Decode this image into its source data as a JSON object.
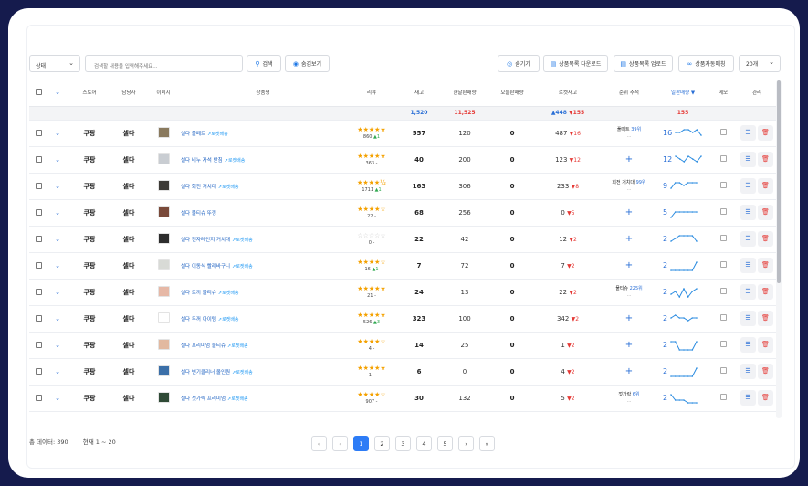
{
  "toolbar": {
    "status_select": "상태",
    "search_placeholder": "검색할 내용을 입력해주세요...",
    "search_btn": "검색",
    "hidden_view_btn": "숨김보기",
    "hide_btn": "숨기기",
    "download_btn": "상품목록 다운로드",
    "upload_btn": "상품목록 업로드",
    "auto_match_btn": "상품자동매칭",
    "page_size": "20개"
  },
  "columns": [
    "스토어",
    "담당자",
    "이미지",
    "상품명",
    "리뷰",
    "재고",
    "한달판매량",
    "오늘판매량",
    "로켓재고",
    "순위 추적",
    "일판매량 ▼",
    "메모",
    "관리"
  ],
  "summary": {
    "stock": "1,520",
    "month_sales": "11,525",
    "rocket_up": "▲448",
    "rocket_down": "▼155",
    "daily": "155"
  },
  "rows": [
    {
      "store": "쿠팡",
      "manager": "셀다",
      "name": "셀다 풀떼트",
      "tag": "로켓배송",
      "stars": "★★★★★",
      "rev_count": "860",
      "rev_delta": "▲1",
      "stock": "557",
      "month": "120",
      "today": "0",
      "rocket": "487",
      "rocket_delta": "▼16",
      "rank_kw": "풀떼트",
      "rank_pos": "39위",
      "rank_sub": "...",
      "rank_plus": "",
      "daily": "16",
      "thumb": "#8a7a5e"
    },
    {
      "store": "쿠팡",
      "manager": "셀다",
      "name": "셀다 비누 자석 받침",
      "tag": "로켓배송",
      "stars": "★★★★★",
      "rev_count": "363",
      "rev_delta": "-",
      "stock": "40",
      "month": "200",
      "today": "0",
      "rocket": "123",
      "rocket_delta": "▼12",
      "rank_kw": "",
      "rank_pos": "",
      "rank_sub": "",
      "rank_plus": "+",
      "daily": "12",
      "thumb": "#c9cdd2"
    },
    {
      "store": "쿠팡",
      "manager": "셀다",
      "name": "셀다 회전 거치대",
      "tag": "로켓배송",
      "stars": "★★★★½",
      "rev_count": "1711",
      "rev_delta": "▲1",
      "stock": "163",
      "month": "306",
      "today": "0",
      "rocket": "233",
      "rocket_delta": "▼8",
      "rank_kw": "회전 거치대",
      "rank_pos": "99위",
      "rank_sub": "...",
      "rank_plus": "",
      "daily": "9",
      "thumb": "#3c3a36"
    },
    {
      "store": "쿠팡",
      "manager": "셀다",
      "name": "셀다 물티슈 뚜껑",
      "tag": "",
      "stars": "★★★★☆",
      "rev_count": "22",
      "rev_delta": "-",
      "stock": "68",
      "month": "256",
      "today": "0",
      "rocket": "0",
      "rocket_delta": "▼5",
      "rank_kw": "",
      "rank_pos": "",
      "rank_sub": "",
      "rank_plus": "+",
      "daily": "5",
      "thumb": "#7a4a3a"
    },
    {
      "store": "쿠팡",
      "manager": "셀다",
      "name": "셀다 전자레인지 거치대",
      "tag": "로켓배송",
      "stars": "☆☆☆☆☆",
      "rev_count": "0",
      "rev_delta": "-",
      "stock": "22",
      "month": "42",
      "today": "0",
      "rocket": "12",
      "rocket_delta": "▼2",
      "rank_kw": "",
      "rank_pos": "",
      "rank_sub": "",
      "rank_plus": "+",
      "daily": "2",
      "thumb": "#2d2d2d"
    },
    {
      "store": "쿠팡",
      "manager": "셀다",
      "name": "셀다 이동식 빨래바구니",
      "tag": "로켓배송",
      "stars": "★★★★☆",
      "rev_count": "16",
      "rev_delta": "▲1",
      "stock": "7",
      "month": "72",
      "today": "0",
      "rocket": "7",
      "rocket_delta": "▼2",
      "rank_kw": "",
      "rank_pos": "",
      "rank_sub": "",
      "rank_plus": "+",
      "daily": "2",
      "thumb": "#d8dad6"
    },
    {
      "store": "쿠팡",
      "manager": "셀다",
      "name": "셀다 토끼 물티슈",
      "tag": "로켓배송",
      "stars": "★★★★★",
      "rev_count": "21",
      "rev_delta": "-",
      "stock": "24",
      "month": "13",
      "today": "0",
      "rocket": "22",
      "rocket_delta": "▼2",
      "rank_kw": "물티슈",
      "rank_pos": "225위",
      "rank_sub": "...",
      "rank_plus": "",
      "daily": "2",
      "thumb": "#e6b8a6"
    },
    {
      "store": "쿠팡",
      "manager": "셀다",
      "name": "셀다 두꺼 아이템",
      "tag": "로켓배송",
      "stars": "★★★★★",
      "rev_count": "526",
      "rev_delta": "▲3",
      "stock": "323",
      "month": "100",
      "today": "0",
      "rocket": "342",
      "rocket_delta": "▼2",
      "rank_kw": "",
      "rank_pos": "",
      "rank_sub": "",
      "rank_plus": "+",
      "daily": "2",
      "thumb": "#ffffff"
    },
    {
      "store": "쿠팡",
      "manager": "셀다",
      "name": "셀다 프리미엄 물티슈",
      "tag": "로켓배송",
      "stars": "★★★★☆",
      "rev_count": "4",
      "rev_delta": "-",
      "stock": "14",
      "month": "25",
      "today": "0",
      "rocket": "1",
      "rocket_delta": "▼2",
      "rank_kw": "",
      "rank_pos": "",
      "rank_sub": "",
      "rank_plus": "+",
      "daily": "2",
      "thumb": "#e2b9a0"
    },
    {
      "store": "쿠팡",
      "manager": "셀다",
      "name": "셀다 변기클리너 올인원",
      "tag": "로켓배송",
      "stars": "★★★★★",
      "rev_count": "1",
      "rev_delta": "-",
      "stock": "6",
      "month": "0",
      "today": "0",
      "rocket": "4",
      "rocket_delta": "▼2",
      "rank_kw": "",
      "rank_pos": "",
      "rank_sub": "",
      "rank_plus": "+",
      "daily": "2",
      "thumb": "#3b6fa8"
    },
    {
      "store": "쿠팡",
      "manager": "셀다",
      "name": "셀다 젓가락 프리미엄",
      "tag": "로켓배송",
      "stars": "★★★★☆",
      "rev_count": "907",
      "rev_delta": "-",
      "stock": "30",
      "month": "132",
      "today": "0",
      "rocket": "5",
      "rocket_delta": "▼2",
      "rank_kw": "젓가락",
      "rank_pos": "6위",
      "rank_sub": "...",
      "rank_plus": "",
      "daily": "2",
      "thumb": "#2f4a36"
    }
  ],
  "sparks": [
    [
      3,
      3,
      4,
      4,
      3,
      4,
      2
    ],
    [
      4,
      3,
      2,
      4,
      3,
      2,
      4
    ],
    [
      2,
      4,
      4,
      3,
      4,
      4,
      4
    ],
    [
      1,
      3,
      3,
      3,
      3,
      3,
      3
    ],
    [
      2,
      3,
      4,
      4,
      4,
      4,
      2
    ],
    [
      1,
      1,
      1,
      1,
      1,
      1,
      4
    ],
    [
      2,
      3,
      1,
      4,
      1,
      3,
      4
    ],
    [
      3,
      4,
      3,
      3,
      2,
      3,
      3
    ],
    [
      4,
      4,
      1,
      1,
      1,
      1,
      4
    ],
    [
      1,
      1,
      1,
      1,
      1,
      1,
      4
    ],
    [
      4,
      2,
      2,
      2,
      1,
      1,
      1
    ]
  ],
  "footer": {
    "total": "총 데이터: 390",
    "range": "현재 1 ~ 20"
  },
  "pager": [
    "«",
    "‹",
    "1",
    "2",
    "3",
    "4",
    "5",
    "›",
    "»"
  ],
  "colors": {
    "accent": "#2d7cf6",
    "down": "#e53935",
    "star": "#f4a100",
    "frame": "#151b4d"
  }
}
